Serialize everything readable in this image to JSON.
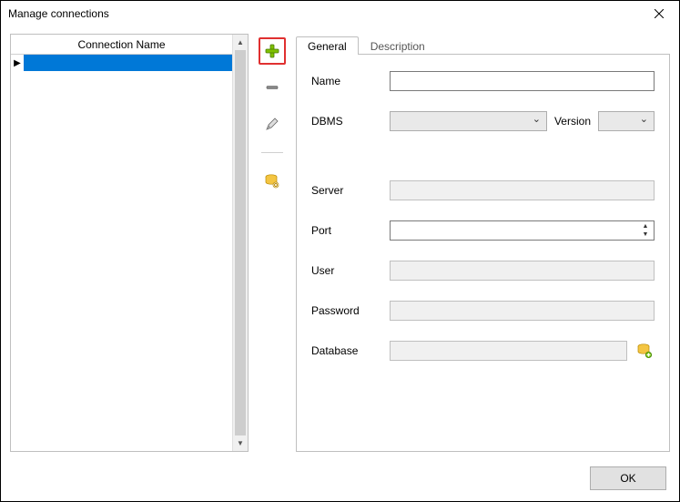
{
  "window": {
    "title": "Manage connections"
  },
  "list": {
    "header": "Connection Name",
    "selected_value": ""
  },
  "tabs": {
    "general": "General",
    "description": "Description"
  },
  "form": {
    "name_label": "Name",
    "name_value": "",
    "dbms_label": "DBMS",
    "dbms_value": "",
    "version_label": "Version",
    "version_value": "",
    "server_label": "Server",
    "server_value": "",
    "port_label": "Port",
    "port_value": "",
    "user_label": "User",
    "user_value": "",
    "password_label": "Password",
    "password_value": "",
    "database_label": "Database",
    "database_value": ""
  },
  "buttons": {
    "ok": "OK"
  },
  "icons": {
    "add": "plus-icon",
    "remove": "minus-icon",
    "edit": "pencil-icon",
    "link": "database-link-icon",
    "db_add": "database-add-icon"
  }
}
